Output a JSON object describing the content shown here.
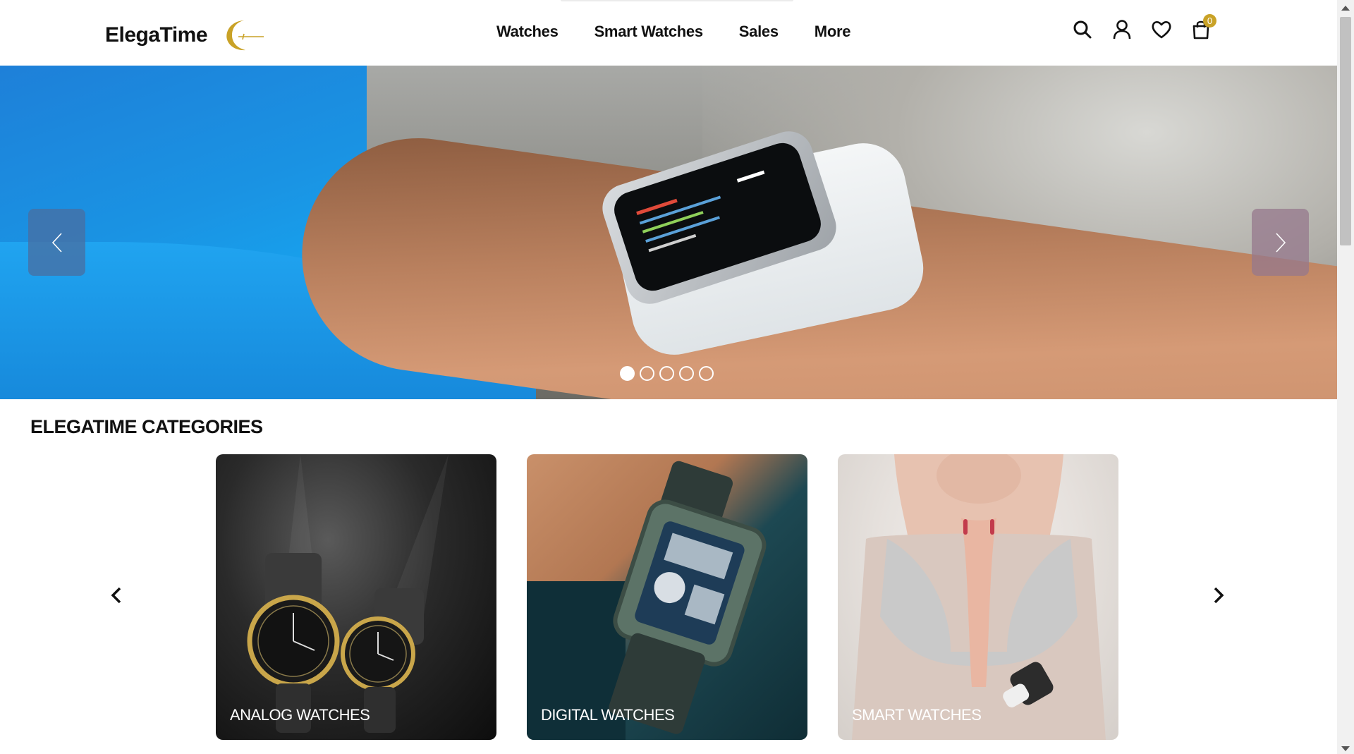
{
  "brand": {
    "name": "ElegaTime",
    "accent_color": "#c9a227"
  },
  "nav": {
    "items": [
      {
        "label": "Watches"
      },
      {
        "label": "Smart Watches"
      },
      {
        "label": "Sales"
      },
      {
        "label": "More"
      }
    ]
  },
  "header_icons": {
    "search": "search-icon",
    "account": "user-icon",
    "wishlist": "heart-icon",
    "cart": "shopping-bag-icon",
    "cart_count": "0"
  },
  "hero": {
    "slide_count": 5,
    "active_slide": 1
  },
  "categories": {
    "title": "ELEGATIME CATEGORIES",
    "items": [
      {
        "label": "ANALOG WATCHES"
      },
      {
        "label": "DIGITAL WATCHES"
      },
      {
        "label": "SMART WATCHES"
      }
    ]
  }
}
